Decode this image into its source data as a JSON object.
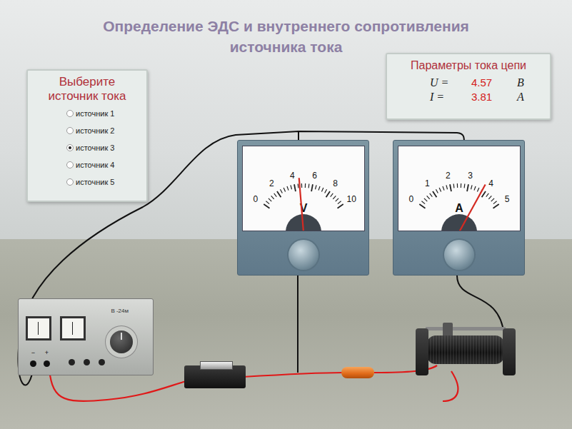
{
  "title_lines": [
    "Определение ЭДС и внутреннего сопротивления",
    "источника тока"
  ],
  "source_panel": {
    "title_lines": [
      "Выберите",
      "источник тока"
    ],
    "options": [
      {
        "label": "источник 1",
        "selected": false
      },
      {
        "label": "источник 2",
        "selected": false
      },
      {
        "label": "источник 3",
        "selected": true
      },
      {
        "label": "источник 4",
        "selected": false
      },
      {
        "label": "источник 5",
        "selected": false
      }
    ]
  },
  "params": {
    "title": "Параметры тока цепи",
    "rows": [
      {
        "name": "U =",
        "value": "4.57",
        "unit": "В"
      },
      {
        "name": "I =",
        "value": "3.81",
        "unit": "А"
      }
    ]
  },
  "meters": [
    {
      "name": "voltmeter",
      "ticks": [
        "0",
        "2",
        "4",
        "6",
        "8",
        "10"
      ],
      "symbol": "V",
      "level": 0.457
    },
    {
      "name": "ammeter",
      "ticks": [
        "0",
        "1",
        "2",
        "3",
        "4",
        "5"
      ],
      "symbol": "A",
      "level": 0.762
    }
  ],
  "power_supply": {
    "model": "В -24м",
    "terminals": [
      "−",
      "+"
    ]
  }
}
